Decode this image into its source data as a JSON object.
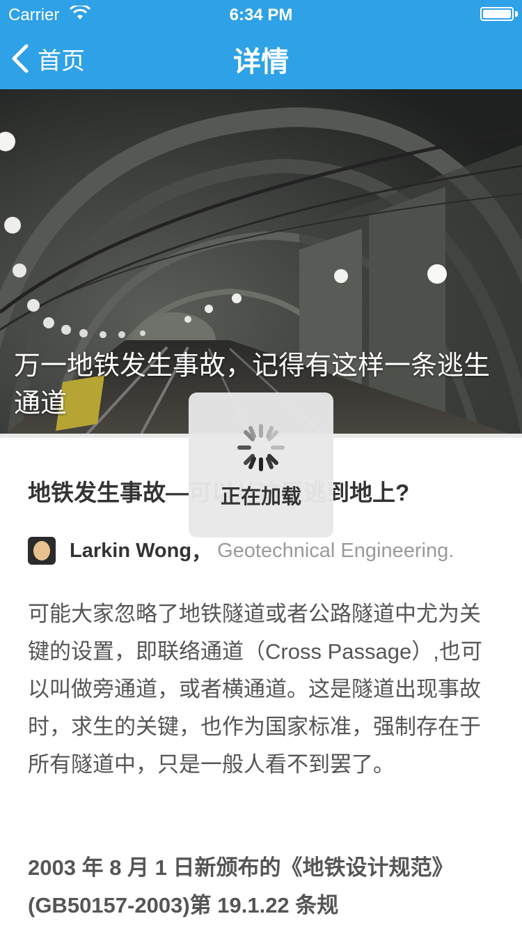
{
  "status_bar": {
    "carrier": "Carrier",
    "time": "6:34 PM"
  },
  "nav": {
    "back_label": "首页",
    "title": "详情"
  },
  "hero": {
    "title": "万一地铁发生事故，记得有这样一条逃生通道"
  },
  "article": {
    "headline": "地铁发生事故—可以从这里逃到地上?",
    "author_name": "Larkin Wong",
    "author_separator": "，",
    "author_bio": "Geotechnical Engineering.",
    "paragraph_1": "可能大家忽略了地铁隧道或者公路隧道中尤为关键的设置，即联络通道（Cross Passage）,也可以叫做旁通道，或者横通道。这是隧道出现事故时，求生的关键，也作为国家标准，强制存在于所有隧道中，只是一般人看不到罢了。",
    "paragraph_2": "2003 年 8 月 1 日新颁布的《地铁设计规范》 (GB50157-2003)第 19.1.22 条规"
  },
  "loading": {
    "label": "正在加载"
  },
  "colors": {
    "nav_bg": "#2fa1e6",
    "text_primary": "#333333",
    "text_secondary": "#9a9a9a"
  }
}
